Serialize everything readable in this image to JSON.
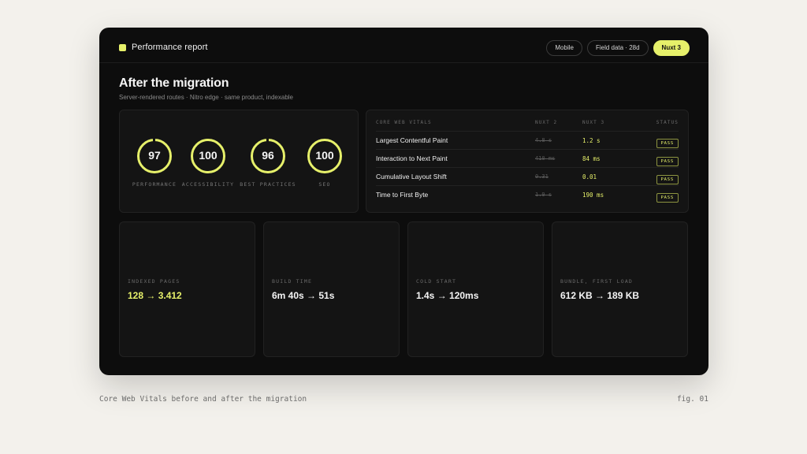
{
  "header": {
    "title": "Performance report",
    "pills": [
      "Mobile",
      "Field data · 28d",
      "Nuxt 3"
    ]
  },
  "page": {
    "title": "After the migration",
    "subtitle": "Server-rendered routes · Nitro edge · same product, indexable"
  },
  "scores": [
    {
      "value": "97",
      "label": "PERFORMANCE"
    },
    {
      "value": "100",
      "label": "ACCESSIBILITY"
    },
    {
      "value": "96",
      "label": "BEST PRACTICES"
    },
    {
      "value": "100",
      "label": "SEO"
    }
  ],
  "vitals": {
    "headers": {
      "metric": "CORE WEB VITALS",
      "old": "NUXT 2",
      "new": "NUXT 3",
      "status": "STATUS"
    },
    "rows": [
      {
        "metric": "Largest Contentful Paint",
        "old": "4.8 s",
        "new": "1.2 s",
        "status": "PASS"
      },
      {
        "metric": "Interaction to Next Paint",
        "old": "410 ms",
        "new": "84 ms",
        "status": "PASS"
      },
      {
        "metric": "Cumulative Layout Shift",
        "old": "0.31",
        "new": "0.01",
        "status": "PASS"
      },
      {
        "metric": "Time to First Byte",
        "old": "1.9 s",
        "new": "190 ms",
        "status": "PASS"
      }
    ]
  },
  "stats": [
    {
      "label": "INDEXED PAGES",
      "value": "128 → 3.412"
    },
    {
      "label": "BUILD TIME",
      "value": "6m 40s → 51s"
    },
    {
      "label": "COLD START",
      "value": "1.4s → 120ms"
    },
    {
      "label": "BUNDLE, FIRST LOAD",
      "value": "612 KB → 189 KB"
    }
  ],
  "caption": "Core Web Vitals before and after the migration",
  "fig_label": "fig. 01",
  "colors": {
    "accent": "#e6f06a",
    "panel": "#141414",
    "window": "#0d0d0d",
    "page": "#f3f1ec"
  }
}
